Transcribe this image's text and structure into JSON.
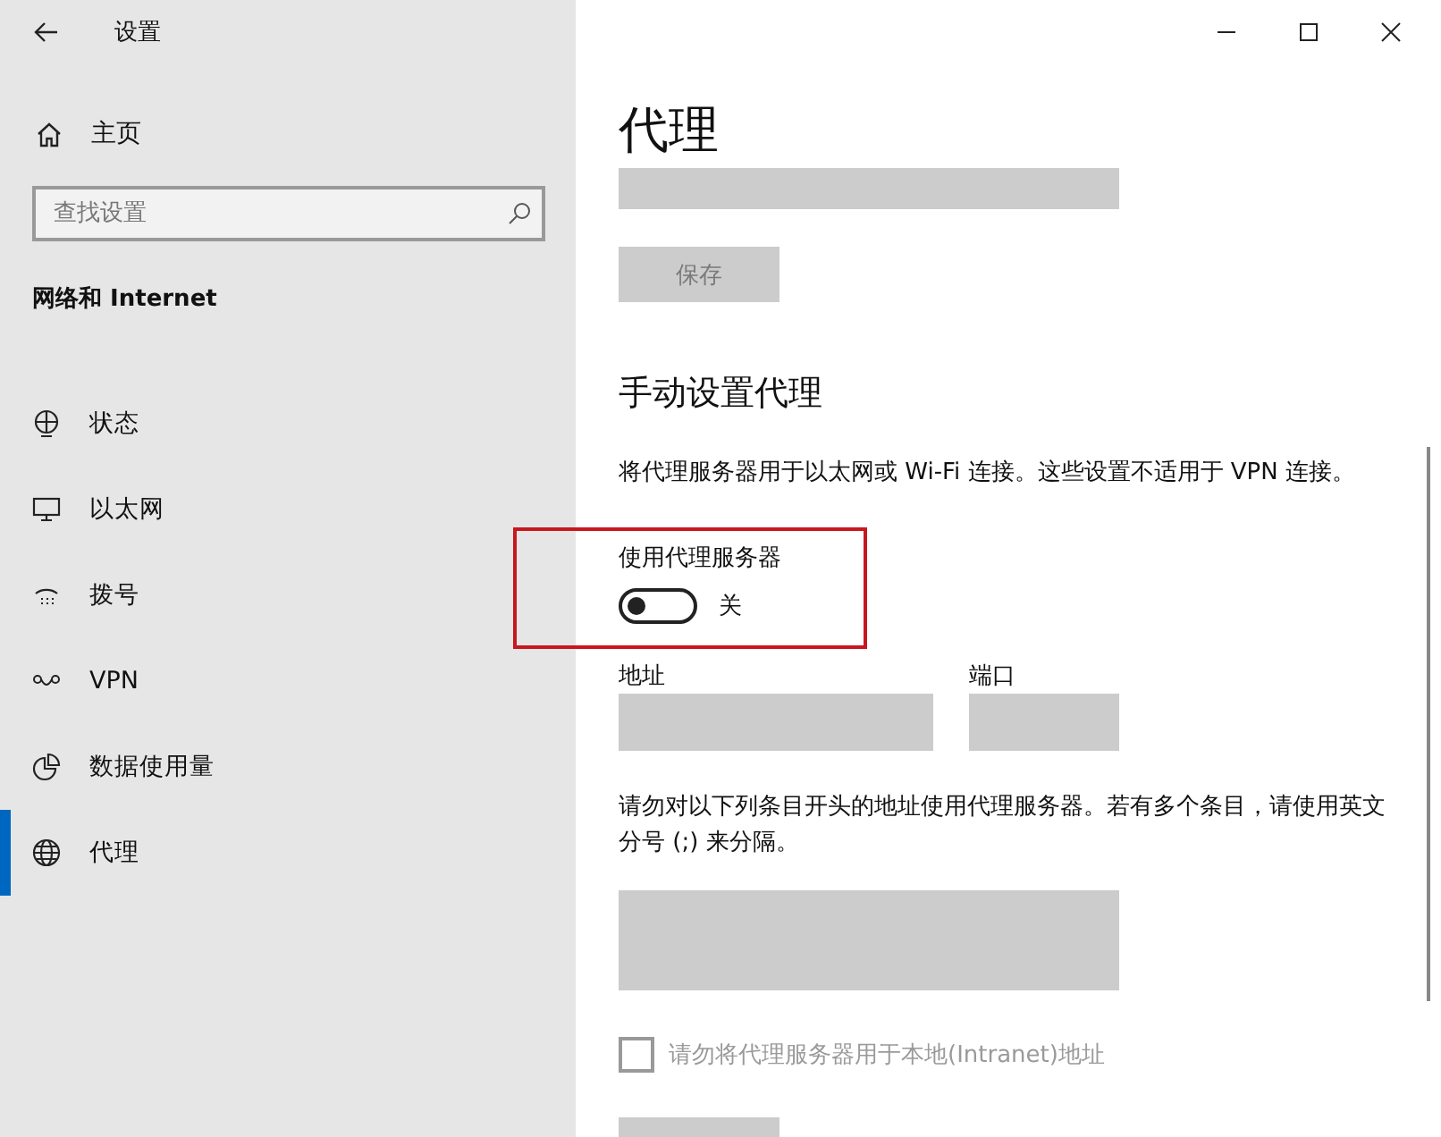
{
  "window": {
    "title": "设置"
  },
  "sidebar": {
    "home": "主页",
    "search": {
      "placeholder": "查找设置"
    },
    "section": "网络和 Internet",
    "items": [
      {
        "label": "状态",
        "kind": "status",
        "selected": false
      },
      {
        "label": "以太网",
        "kind": "ethernet",
        "selected": false
      },
      {
        "label": "拨号",
        "kind": "dialup",
        "selected": false
      },
      {
        "label": "VPN",
        "kind": "vpn",
        "selected": false
      },
      {
        "label": "数据使用量",
        "kind": "data",
        "selected": false
      },
      {
        "label": "代理",
        "kind": "proxy",
        "selected": true
      }
    ]
  },
  "page": {
    "title": "代理",
    "script_field": {
      "disabled": true
    },
    "save_button": {
      "label": "保存",
      "disabled": true
    },
    "manual": {
      "heading": "手动设置代理",
      "description": "将代理服务器用于以太网或 Wi-Fi 连接。这些设置不适用于 VPN 连接。",
      "toggle": {
        "label": "使用代理服务器",
        "on": false,
        "state_text": "关",
        "highlighted": true
      },
      "address": {
        "label": "地址",
        "disabled": true
      },
      "port": {
        "label": "端口",
        "disabled": true
      },
      "exceptions_note": "请勿对以下列条目开头的地址使用代理服务器。若有多个条目，请使用英文分号 (;) 来分隔。",
      "exceptions": {
        "disabled": true
      },
      "local_checkbox": {
        "label": "请勿将代理服务器用于本地(Intranet)地址",
        "checked": false,
        "disabled": true
      }
    }
  }
}
